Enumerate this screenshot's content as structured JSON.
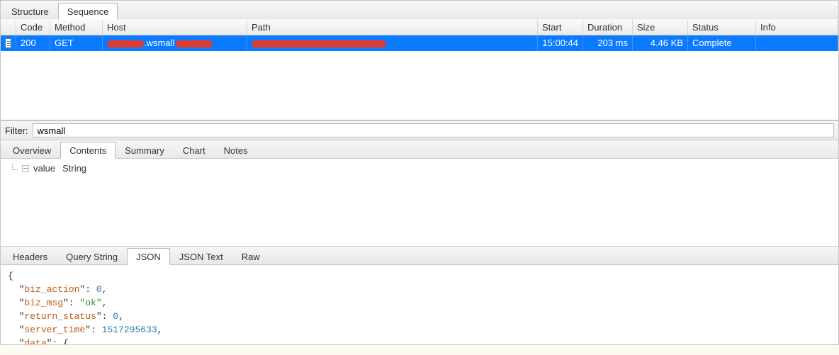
{
  "top_tabs": {
    "structure": "Structure",
    "sequence": "Sequence",
    "active": "sequence"
  },
  "columns": {
    "code": "Code",
    "method": "Method",
    "host": "Host",
    "path": "Path",
    "start": "Start",
    "duration": "Duration",
    "size": "Size",
    "status": "Status",
    "info": "Info"
  },
  "rows": [
    {
      "code": "200",
      "method": "GET",
      "host_fragment": ".wsmall",
      "path_fragment": "",
      "start": "15:00:44",
      "duration": "203 ms",
      "size": "4.46 KB",
      "status": "Complete",
      "info": ""
    }
  ],
  "filter": {
    "label": "Filter:",
    "value": "wsmall"
  },
  "mid_tabs": {
    "overview": "Overview",
    "contents": "Contents",
    "summary": "Summary",
    "chart": "Chart",
    "notes": "Notes",
    "active": "contents"
  },
  "tree": {
    "node_label": "value",
    "node_type": "String"
  },
  "bot_tabs": {
    "headers": "Headers",
    "query": "Query String",
    "json": "JSON",
    "json_text": "JSON Text",
    "raw": "Raw",
    "active": "json"
  },
  "json": {
    "biz_action_key": "biz_action",
    "biz_action_val": "0",
    "biz_msg_key": "biz_msg",
    "biz_msg_val": "\"ok\"",
    "return_status_key": "return_status",
    "return_status_val": "0",
    "server_time_key": "server_time",
    "server_time_val": "1517295633",
    "data_key": "data"
  }
}
